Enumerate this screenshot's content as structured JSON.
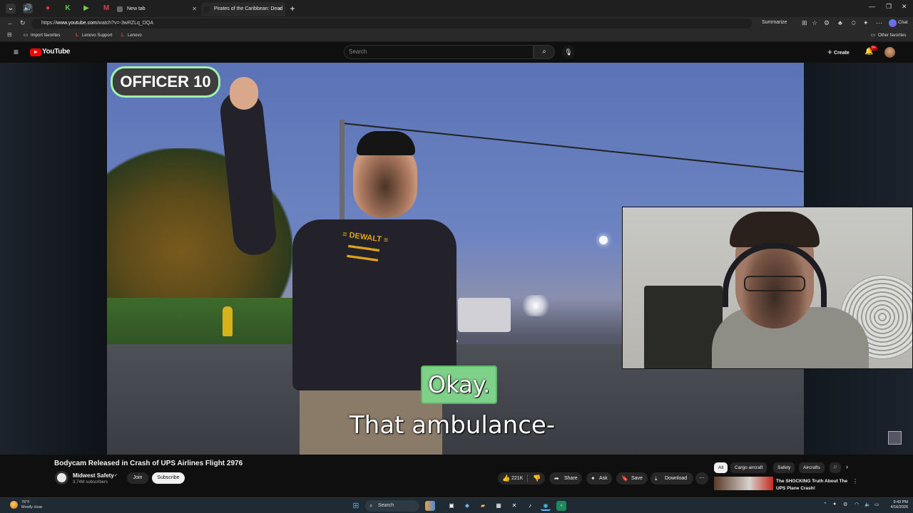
{
  "browser": {
    "tabs": [
      {
        "title": "New tab"
      },
      {
        "title": "Pirates of the Caribbean: Dead M..."
      }
    ],
    "url_prefix": "https://",
    "url_host": "www.youtube.com",
    "url_path": "/watch?v=-3wRZLq_DQA",
    "summarize_label": "Summarize",
    "chat_label": "Chat",
    "favorites": [
      {
        "label": "Import favorites"
      },
      {
        "label": "Lenovo Support"
      },
      {
        "label": "Lenovo"
      }
    ],
    "other_favorites": "Other favorites"
  },
  "youtube": {
    "logo_text": "YouTube",
    "search_placeholder": "Search",
    "create_label": "Create",
    "notification_badge": "9+"
  },
  "video": {
    "overlay_badge": "OFFICER 10",
    "caption_line1": "Okay.",
    "caption_line2": "That ambulance-"
  },
  "info": {
    "title": "Bodycam Released in Crash of UPS Airlines Flight 2976",
    "channel_name": "Midwest Safety",
    "subscribers": "3.74M subscribers",
    "join_label": "Join",
    "subscribe_label": "Subscribe",
    "likes": "221K",
    "share_label": "Share",
    "ask_label": "Ask",
    "save_label": "Save",
    "download_label": "Download",
    "chips": [
      "All",
      "Cargo aircraft",
      "Safety",
      "Aircrafts",
      "P"
    ],
    "rec_title": "The SHOCKING Truth About The UPS Plane Crash!"
  },
  "taskbar": {
    "temperature": "76°F",
    "weather": "Mostly clear",
    "search_label": "Search",
    "time": "9:43 PM",
    "date": "4/16/2026"
  },
  "colors": {
    "accent_red": "#ff0000",
    "caption_green": "#7fd18a",
    "badge_border": "#9ff0b0"
  }
}
